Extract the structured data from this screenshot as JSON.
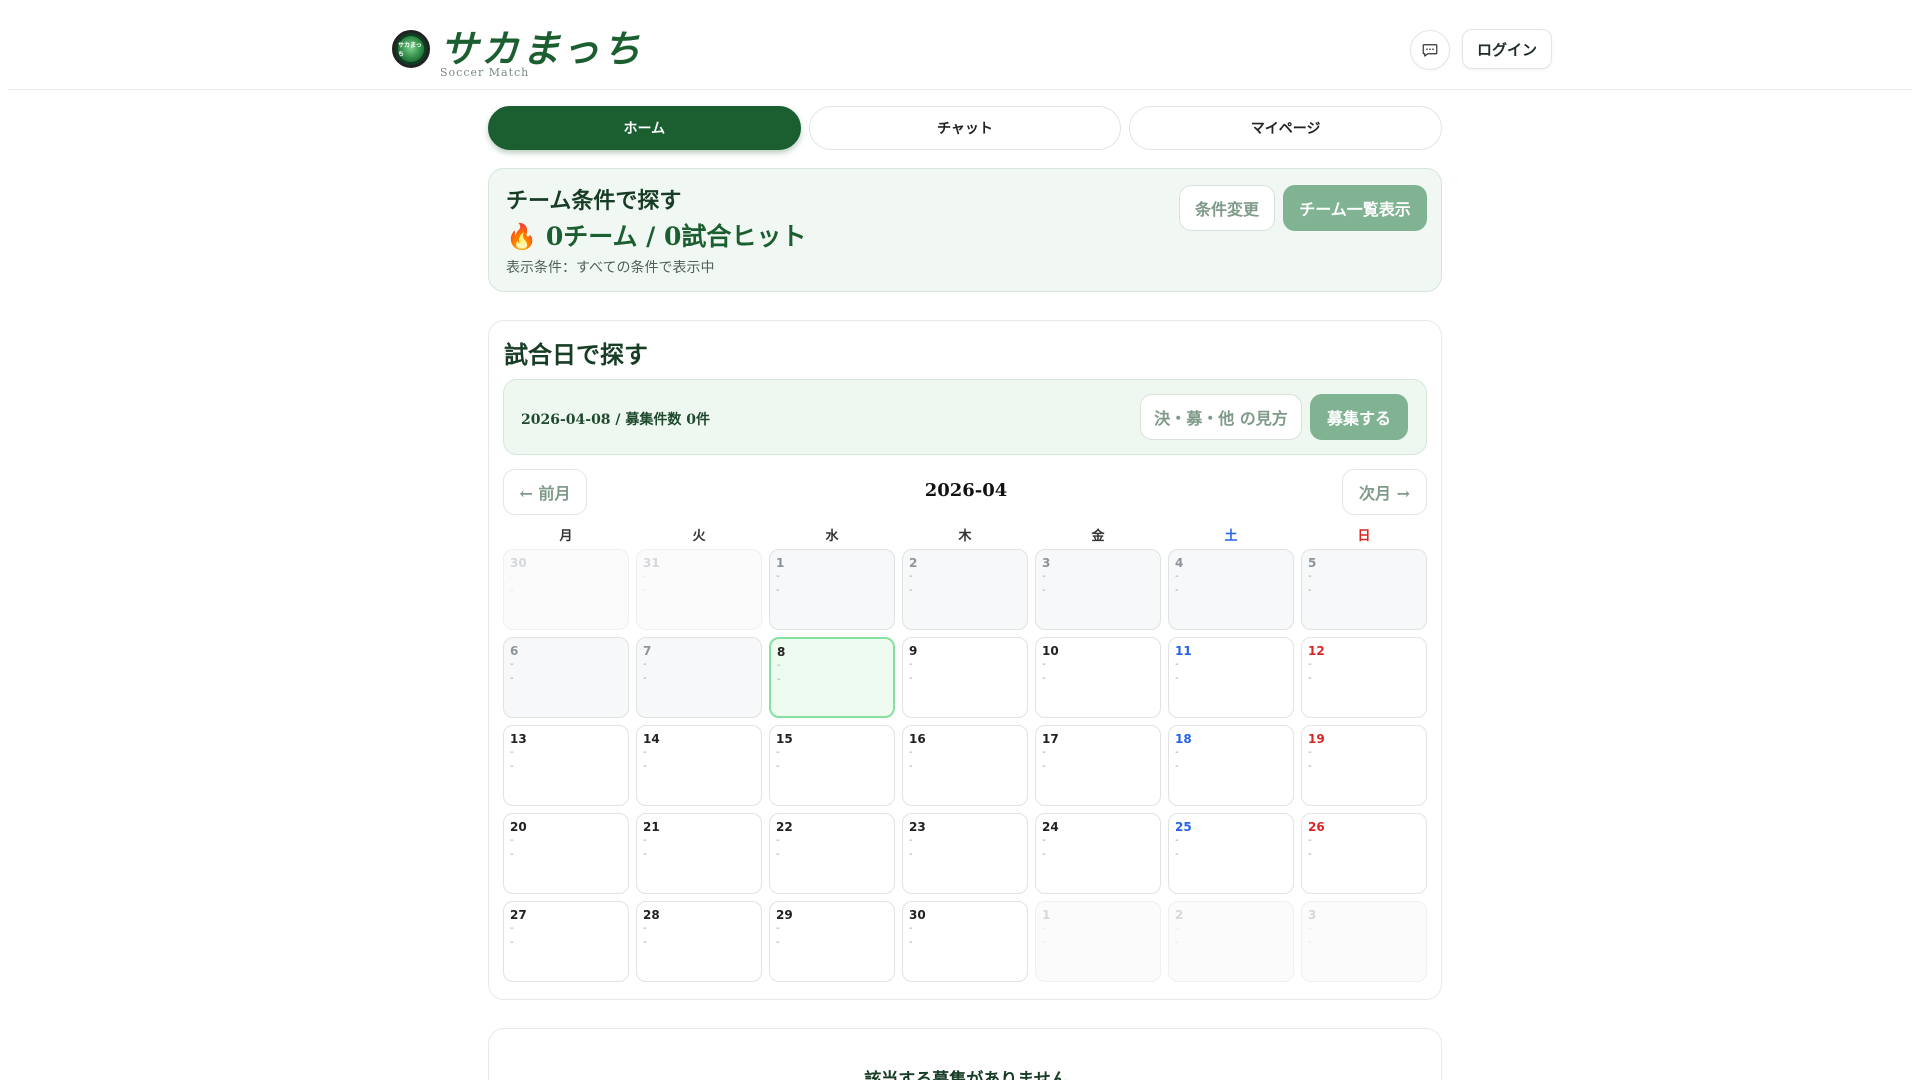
{
  "header": {
    "logo_text": "サカまっち",
    "logo_sub": "Soccer Match",
    "logo_badge_text": "サカまっち",
    "login_label": "ログイン"
  },
  "tabs": [
    {
      "label": "ホーム",
      "active": true
    },
    {
      "label": "チャット",
      "active": false
    },
    {
      "label": "マイページ",
      "active": false
    }
  ],
  "team_search": {
    "title": "チーム条件で探す",
    "hits": "🔥 0チーム / 0試合ヒット",
    "condition": "表示条件：すべての条件で表示中",
    "change_label": "条件変更",
    "list_label": "チーム一覧表示"
  },
  "date_search": {
    "title": "試合日で探す",
    "info": "2026-04-08 / 募集件数 0件",
    "legend_label": "決・募・他 の見方",
    "recruit_label": "募集する",
    "prev_label": "← 前月",
    "next_label": "次月 →",
    "month": "2026-04",
    "weekdays": [
      "月",
      "火",
      "水",
      "木",
      "金",
      "土",
      "日"
    ],
    "days": [
      {
        "n": "30",
        "l1": "-",
        "l2": "-",
        "state": "out"
      },
      {
        "n": "31",
        "l1": "-",
        "l2": "-",
        "state": "out"
      },
      {
        "n": "1",
        "l1": "-",
        "l2": "-",
        "state": "past"
      },
      {
        "n": "2",
        "l1": "-",
        "l2": "-",
        "state": "past"
      },
      {
        "n": "3",
        "l1": "-",
        "l2": "-",
        "state": "past"
      },
      {
        "n": "4",
        "l1": "-",
        "l2": "-",
        "state": "past"
      },
      {
        "n": "5",
        "l1": "-",
        "l2": "-",
        "state": "past"
      },
      {
        "n": "6",
        "l1": "-",
        "l2": "-",
        "state": "past"
      },
      {
        "n": "7",
        "l1": "-",
        "l2": "-",
        "state": "past"
      },
      {
        "n": "8",
        "l1": "-",
        "l2": "-",
        "state": "today"
      },
      {
        "n": "9",
        "l1": "-",
        "l2": "-",
        "state": "normal"
      },
      {
        "n": "10",
        "l1": "-",
        "l2": "-",
        "state": "normal"
      },
      {
        "n": "11",
        "l1": "-",
        "l2": "-",
        "state": "normal"
      },
      {
        "n": "12",
        "l1": "-",
        "l2": "-",
        "state": "normal"
      },
      {
        "n": "13",
        "l1": "-",
        "l2": "-",
        "state": "normal"
      },
      {
        "n": "14",
        "l1": "-",
        "l2": "-",
        "state": "normal"
      },
      {
        "n": "15",
        "l1": "-",
        "l2": "-",
        "state": "normal"
      },
      {
        "n": "16",
        "l1": "-",
        "l2": "-",
        "state": "normal"
      },
      {
        "n": "17",
        "l1": "-",
        "l2": "-",
        "state": "normal"
      },
      {
        "n": "18",
        "l1": "-",
        "l2": "-",
        "state": "normal"
      },
      {
        "n": "19",
        "l1": "-",
        "l2": "-",
        "state": "normal"
      },
      {
        "n": "20",
        "l1": "-",
        "l2": "-",
        "state": "normal"
      },
      {
        "n": "21",
        "l1": "-",
        "l2": "-",
        "state": "normal"
      },
      {
        "n": "22",
        "l1": "-",
        "l2": "-",
        "state": "normal"
      },
      {
        "n": "23",
        "l1": "-",
        "l2": "-",
        "state": "normal"
      },
      {
        "n": "24",
        "l1": "-",
        "l2": "-",
        "state": "normal"
      },
      {
        "n": "25",
        "l1": "-",
        "l2": "-",
        "state": "normal"
      },
      {
        "n": "26",
        "l1": "-",
        "l2": "-",
        "state": "normal"
      },
      {
        "n": "27",
        "l1": "-",
        "l2": "-",
        "state": "normal"
      },
      {
        "n": "28",
        "l1": "-",
        "l2": "-",
        "state": "normal"
      },
      {
        "n": "29",
        "l1": "-",
        "l2": "-",
        "state": "normal"
      },
      {
        "n": "30",
        "l1": "-",
        "l2": "-",
        "state": "normal"
      },
      {
        "n": "1",
        "l1": "-",
        "l2": "-",
        "state": "out"
      },
      {
        "n": "2",
        "l1": "-",
        "l2": "-",
        "state": "out"
      },
      {
        "n": "3",
        "l1": "-",
        "l2": "-",
        "state": "out"
      }
    ]
  },
  "results": {
    "empty_text": "該当する募集がありません"
  },
  "colors": {
    "brand": "#1b5e30",
    "accent_soft": "#7fb391",
    "saturday": "#2563eb",
    "sunday": "#dc2626",
    "today_border": "#86e0a0"
  },
  "icons": {
    "chat": "chat-bubble-icon"
  }
}
